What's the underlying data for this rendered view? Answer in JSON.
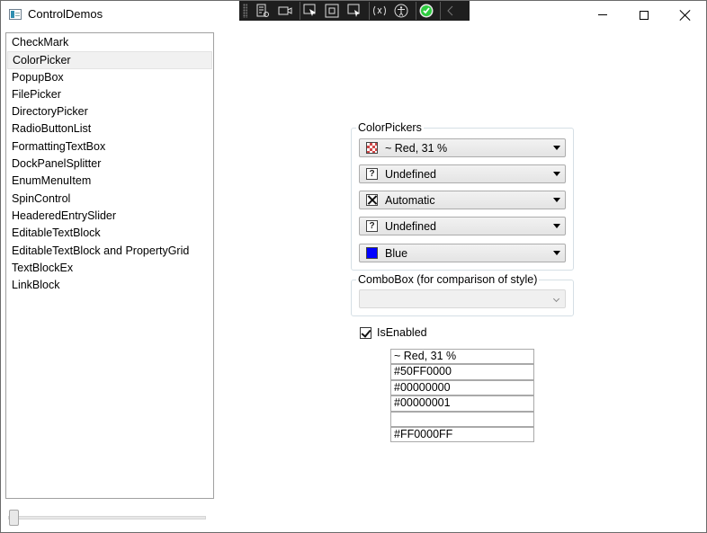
{
  "window": {
    "title": "ControlDemos"
  },
  "devbar": {
    "tools": [
      "live-visual-tree-icon",
      "record-icon",
      "select-element-icon",
      "display-adorners-icon",
      "track-focus-icon",
      "binding-failures-icon",
      "accessibility-icon",
      "check-circle-icon",
      "collapse-chevron-icon"
    ]
  },
  "sidebar": {
    "items": [
      {
        "label": "CheckMark"
      },
      {
        "label": "ColorPicker",
        "selected": true
      },
      {
        "label": "PopupBox"
      },
      {
        "label": "FilePicker"
      },
      {
        "label": "DirectoryPicker"
      },
      {
        "label": "RadioButtonList"
      },
      {
        "label": "FormattingTextBox"
      },
      {
        "label": "DockPanelSplitter"
      },
      {
        "label": "EnumMenuItem"
      },
      {
        "label": "SpinControl"
      },
      {
        "label": "HeaderedEntrySlider"
      },
      {
        "label": "EditableTextBlock"
      },
      {
        "label": "EditableTextBlock and PropertyGrid"
      },
      {
        "label": "TextBlockEx"
      },
      {
        "label": "LinkBlock"
      }
    ]
  },
  "slider": {
    "value": 0
  },
  "color_pickers": {
    "label": "ColorPickers",
    "pickers": [
      {
        "text": "~ Red, 31 %",
        "swatch": "checker"
      },
      {
        "text": "Undefined",
        "swatch": "undefined",
        "glyph": "?"
      },
      {
        "text": "Automatic",
        "swatch": "automatic"
      },
      {
        "text": "Undefined",
        "swatch": "undefined",
        "glyph": "?"
      },
      {
        "text": "Blue",
        "swatch": "blue",
        "color": "#0000FF"
      }
    ]
  },
  "combobox_group": {
    "label": "ComboBox (for comparison of style)",
    "value": ""
  },
  "isenabled": {
    "label": "IsEnabled",
    "checked": true
  },
  "textboxes": [
    "~ Red, 31 %",
    "#50FF0000",
    "#00000000",
    "#00000001",
    "",
    "#FF0000FF"
  ],
  "colors": {
    "accent_check": "#2ecc40",
    "blue": "#0000FF",
    "red": "#FF0000"
  }
}
